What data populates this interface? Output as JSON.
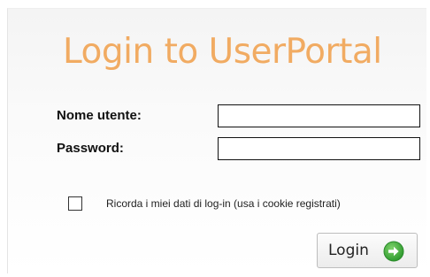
{
  "header": {
    "title": "Login to UserPortal"
  },
  "form": {
    "username_label": "Nome utente:",
    "username_value": "",
    "password_label": "Password:",
    "password_value": "",
    "remember_checked": false,
    "remember_label": "Ricorda i miei dati di log-in (usa i cookie registrati)",
    "login_label": "Login",
    "login_icon": "arrow-right-circle-icon"
  },
  "colors": {
    "title": "#f1ab62",
    "login_icon": "#3aa53a"
  }
}
